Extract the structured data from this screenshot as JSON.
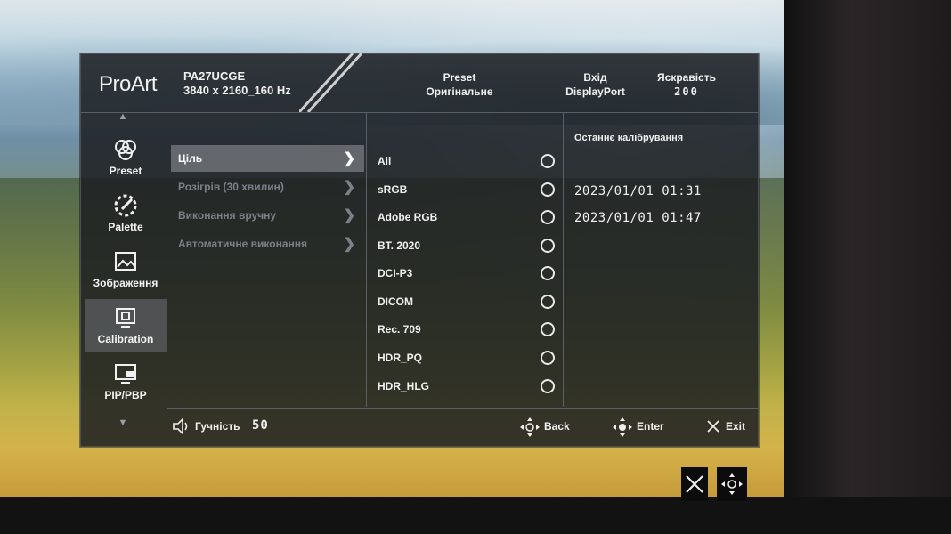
{
  "header": {
    "brand": "ProArt",
    "model": "PA27UCGE",
    "resolution": "3840 x 2160_160 Hz",
    "preset_label": "Preset",
    "preset_value": "Оригінальне",
    "input_label": "Вхід",
    "input_value": "DisplayPort",
    "brightness_label": "Яскравість",
    "brightness_value": "200"
  },
  "sidebar": {
    "items": [
      {
        "label": "Preset",
        "icon": "preset-icon"
      },
      {
        "label": "Palette",
        "icon": "palette-icon"
      },
      {
        "label": "Зображення",
        "icon": "image-icon"
      },
      {
        "label": "Calibration",
        "icon": "calibration-icon",
        "active": true
      },
      {
        "label": "PIP/PBP",
        "icon": "pip-icon"
      }
    ]
  },
  "menu1": {
    "items": [
      {
        "label": "Ціль",
        "selected": true
      },
      {
        "label": "Розігрів (30 хвилин)"
      },
      {
        "label": "Виконання вручну"
      },
      {
        "label": "Автоматичне виконання"
      }
    ]
  },
  "menu2": {
    "items": [
      "All",
      "sRGB",
      "Adobe RGB",
      "BT. 2020",
      "DCI-P3",
      "DICOM",
      "Rec. 709",
      "HDR_PQ",
      "HDR_HLG"
    ]
  },
  "menu3": {
    "title": "Останнє калібрування",
    "dates": [
      "2023/01/01  01:31",
      "2023/01/01  01:47"
    ]
  },
  "footer": {
    "volume_label": "Гучність",
    "volume_value": "50",
    "back_label": "Back",
    "enter_label": "Enter",
    "exit_label": "Exit"
  }
}
